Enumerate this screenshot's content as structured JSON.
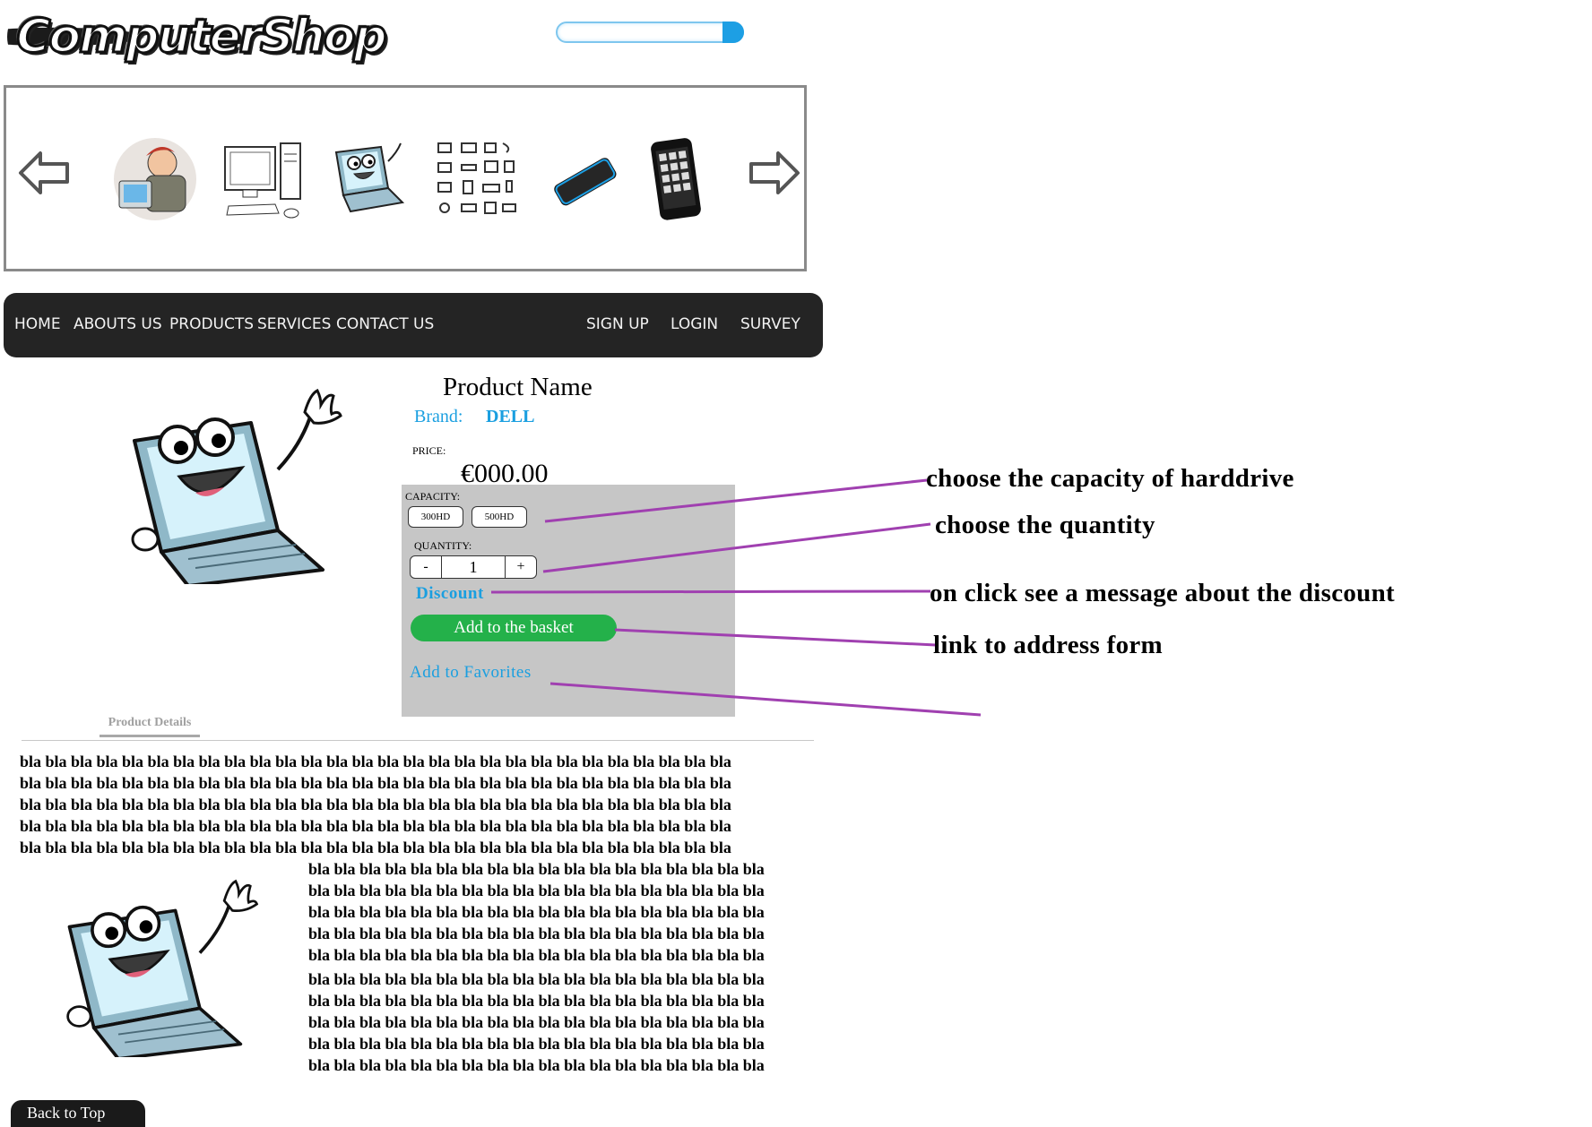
{
  "logo": {
    "text": "ComputerShop"
  },
  "search": {
    "value": "",
    "placeholder": ""
  },
  "nav": {
    "left_items": [
      "HOME",
      "ABOUTS US",
      "PRODUCTS",
      "SERVICES",
      "CONTACT US"
    ],
    "right_items": [
      "SIGN UP",
      "LOGIN",
      "SURVEY"
    ]
  },
  "product": {
    "name": "Product Name",
    "brand_label": "Brand:",
    "brand": "DELL",
    "price_label": "PRICE:",
    "price": "€000.00",
    "capacity_label": "CAPACITY:",
    "capacity_options": [
      "300HD",
      "500HD"
    ],
    "quantity_label": "QUANTITY:",
    "quantity": "1",
    "minus": "-",
    "plus": "+",
    "discount_link": "Discount",
    "add_to_basket": "Add to the basket",
    "add_to_favorites": "Add to Favorites"
  },
  "annotations": {
    "capacity": "choose the capacity of harddrive",
    "quantity": "choose the quantity",
    "discount": "on click see a message about the discount",
    "basket": "link to address form"
  },
  "tabs": {
    "details": "Product Details"
  },
  "details_text": {
    "full_line": "bla bla bla bla bla bla bla bla bla bla bla bla bla bla bla bla bla bla bla bla bla bla bla bla bla bla bla bla",
    "short_line": "bla bla bla bla bla bla bla bla bla bla bla bla bla bla bla bla bla bla"
  },
  "back_to_top": "Back to Top",
  "colors": {
    "accent": "#1a9fe0",
    "basket": "#24b14a",
    "nav": "#242424",
    "annotation_line": "#a040b0"
  }
}
